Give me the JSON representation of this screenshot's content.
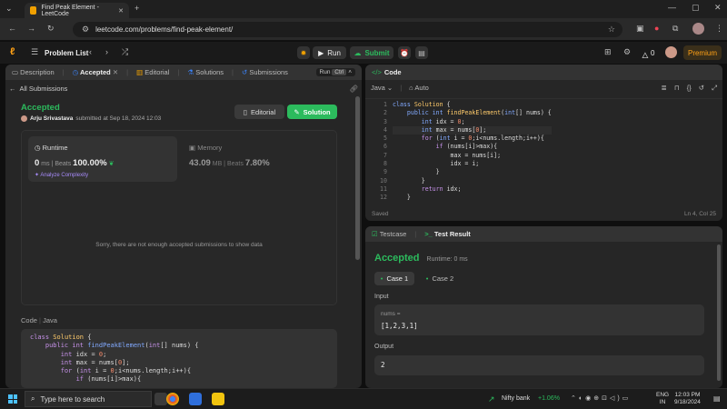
{
  "browser": {
    "tab_title": "Find Peak Element - LeetCode",
    "url": "leetcode.com/problems/find-peak-element/"
  },
  "nav": {
    "problem_list": "Problem List",
    "run": "Run",
    "submit": "Submit",
    "streak": "0",
    "premium": "Premium"
  },
  "left": {
    "tabs": [
      "Description",
      "Accepted",
      "Editorial",
      "Solutions",
      "Submissions"
    ],
    "all_submissions": "All Submissions",
    "run_pill": "Run",
    "ctrl_pill": "Ctrl",
    "status": "Accepted",
    "user": "Arju Srivastava",
    "submitted": "submitted at Sep 18, 2024 12:03",
    "editorial_btn": "Editorial",
    "solution_btn": "Solution",
    "runtime_label": "Runtime",
    "runtime_value": "0",
    "runtime_unit": "ms",
    "beats_label": "Beats",
    "runtime_beats": "100.00%",
    "analyze": "Analyze Complexity",
    "memory_label": "Memory",
    "memory_value": "43.09",
    "memory_unit": "MB",
    "memory_beats": "7.80%",
    "notice": "Sorry, there are not enough accepted submissions to show data",
    "code_label": "Code",
    "code_lang": "Java"
  },
  "editor": {
    "title": "Code",
    "lang": "Java",
    "auto": "Auto",
    "saved": "Saved",
    "position": "Ln 4, Col 25"
  },
  "result": {
    "testcase_tab": "Testcase",
    "result_tab": "Test Result",
    "status": "Accepted",
    "runtime": "Runtime: 0 ms",
    "case1": "Case 1",
    "case2": "Case 2",
    "input_label": "Input",
    "param": "nums =",
    "input_value": "[1,2,3,1]",
    "output_label": "Output",
    "output_value": "2"
  },
  "taskbar": {
    "search": "Type here to search",
    "stock_name": "Nifty bank",
    "stock_change": "+1.06%",
    "lang1": "ENG",
    "lang2": "IN",
    "time": "12:03 PM",
    "date": "9/18/2024"
  },
  "colors": {
    "accent_green": "#2cbb5d",
    "lc_orange": "#ffa116",
    "premium": "#ffa116"
  }
}
